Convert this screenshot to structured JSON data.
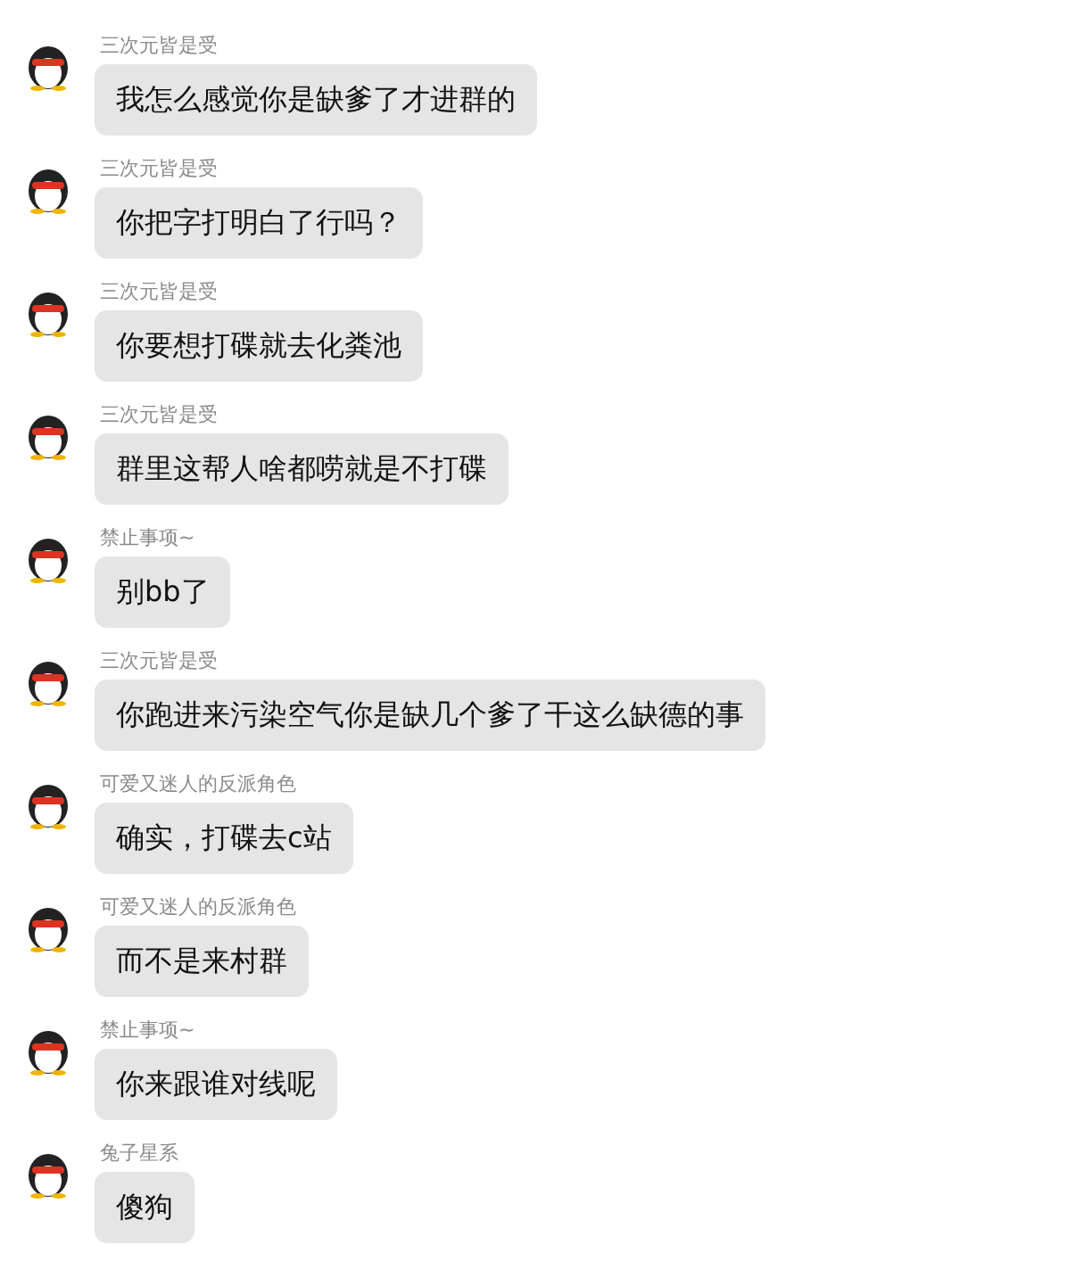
{
  "messages": [
    {
      "sender": "三次元皆是受",
      "text": "我怎么感觉你是缺爹了才进群的"
    },
    {
      "sender": "三次元皆是受",
      "text": "你把字打明白了行吗？"
    },
    {
      "sender": "三次元皆是受",
      "text": "你要想打碟就去化粪池"
    },
    {
      "sender": "三次元皆是受",
      "text": "群里这帮人啥都唠就是不打碟"
    },
    {
      "sender": "禁止事项~",
      "text": "别bb了"
    },
    {
      "sender": "三次元皆是受",
      "text": "你跑进来污染空气你是缺几个爹了干这么缺德的事"
    },
    {
      "sender": "可爱又迷人的反派角色",
      "text": "确实，打碟去c站"
    },
    {
      "sender": "可爱又迷人的反派角色",
      "text": "而不是来村群"
    },
    {
      "sender": "禁止事项~",
      "text": "你来跟谁对线呢"
    },
    {
      "sender": "兔子星系",
      "text": "傻狗"
    }
  ]
}
